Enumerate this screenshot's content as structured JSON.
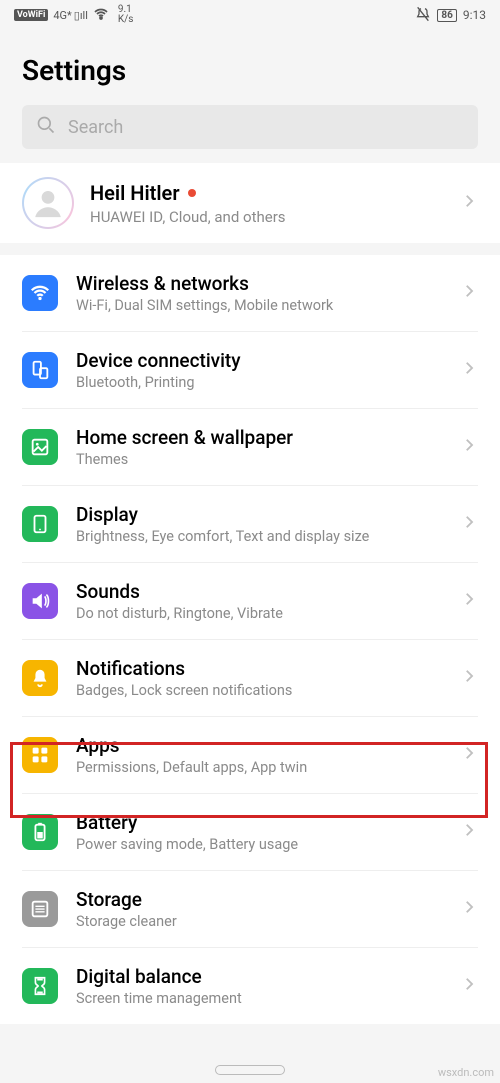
{
  "status_bar": {
    "vowifi": "VoWiFi",
    "network": "4G*",
    "speed_num": "9.1",
    "speed_unit": "K/s",
    "battery": "86",
    "time": "9:13"
  },
  "page_title": "Settings",
  "search": {
    "placeholder": "Search"
  },
  "profile": {
    "name": "Heil Hitler",
    "subtitle": "HUAWEI ID, Cloud, and others"
  },
  "items": [
    {
      "key": "wireless",
      "title": "Wireless & networks",
      "subtitle": "Wi-Fi, Dual SIM settings, Mobile network",
      "color": "#2b7cff"
    },
    {
      "key": "device",
      "title": "Device connectivity",
      "subtitle": "Bluetooth, Printing",
      "color": "#2b7cff"
    },
    {
      "key": "home",
      "title": "Home screen & wallpaper",
      "subtitle": "Themes",
      "color": "#23b85a"
    },
    {
      "key": "display",
      "title": "Display",
      "subtitle": "Brightness, Eye comfort, Text and display size",
      "color": "#23b85a"
    },
    {
      "key": "sounds",
      "title": "Sounds",
      "subtitle": "Do not disturb, Ringtone, Vibrate",
      "color": "#8a53e6"
    },
    {
      "key": "notifications",
      "title": "Notifications",
      "subtitle": "Badges, Lock screen notifications",
      "color": "#f7b500"
    },
    {
      "key": "apps",
      "title": "Apps",
      "subtitle": "Permissions, Default apps, App twin",
      "color": "#f7b500"
    },
    {
      "key": "battery",
      "title": "Battery",
      "subtitle": "Power saving mode, Battery usage",
      "color": "#23b85a"
    },
    {
      "key": "storage",
      "title": "Storage",
      "subtitle": "Storage cleaner",
      "color": "#9a9a9a"
    },
    {
      "key": "digital",
      "title": "Digital balance",
      "subtitle": "Screen time management",
      "color": "#23b85a"
    }
  ],
  "watermark": "wsxdn.com"
}
